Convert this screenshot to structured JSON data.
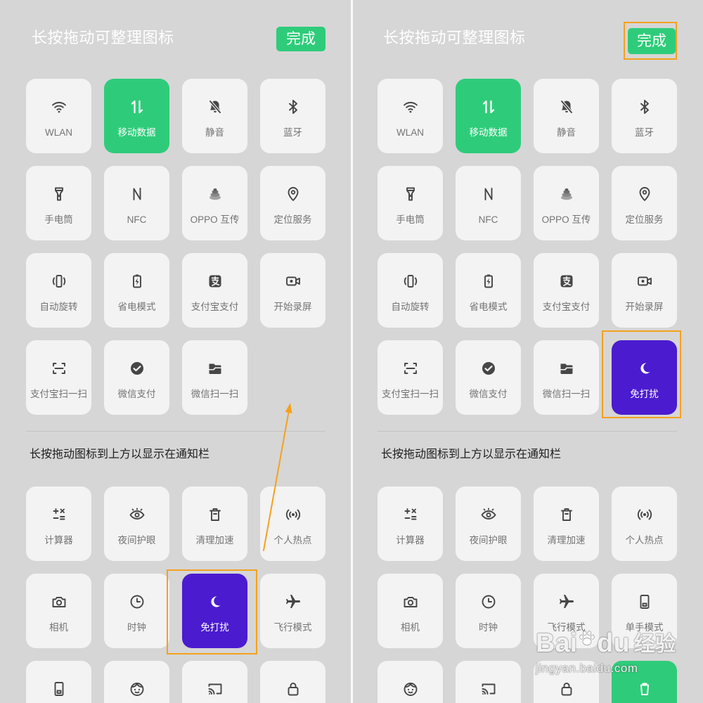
{
  "panels": [
    {
      "title": "长按拖动可整理图标",
      "done_label": "完成",
      "active_tiles": [
        {
          "label": "WLAN",
          "icon": "wifi-icon"
        },
        {
          "label": "移动数据",
          "icon": "mobile-data-icon",
          "variant": "green"
        },
        {
          "label": "静音",
          "icon": "bell-off-icon"
        },
        {
          "label": "蓝牙",
          "icon": "bluetooth-icon"
        },
        {
          "label": "手电筒",
          "icon": "flashlight-icon"
        },
        {
          "label": "NFC",
          "icon": "nfc-icon"
        },
        {
          "label": "OPPO 互传",
          "icon": "oppo-share-icon"
        },
        {
          "label": "定位服务",
          "icon": "location-icon"
        },
        {
          "label": "自动旋转",
          "icon": "rotate-icon"
        },
        {
          "label": "省电模式",
          "icon": "battery-saver-icon"
        },
        {
          "label": "支付宝支付",
          "icon": "alipay-icon"
        },
        {
          "label": "开始录屏",
          "icon": "screen-record-icon"
        },
        {
          "label": "支付宝扫一扫",
          "icon": "scan-icon"
        },
        {
          "label": "微信支付",
          "icon": "wechat-pay-icon"
        },
        {
          "label": "微信扫一扫",
          "icon": "wechat-scan-icon"
        }
      ],
      "section_hint": "长按拖动图标到上方以显示在通知栏",
      "inactive_tiles": [
        {
          "label": "计算器",
          "icon": "calculator-icon"
        },
        {
          "label": "夜间护眼",
          "icon": "eye-icon"
        },
        {
          "label": "清理加速",
          "icon": "cleanup-icon"
        },
        {
          "label": "个人热点",
          "icon": "hotspot-icon"
        },
        {
          "label": "相机",
          "icon": "camera-icon"
        },
        {
          "label": "时钟",
          "icon": "clock-icon"
        },
        {
          "label": "免打扰",
          "icon": "moon-icon",
          "variant": "purple"
        },
        {
          "label": "飞行模式",
          "icon": "airplane-icon"
        },
        {
          "icon": "one-hand-icon"
        },
        {
          "icon": "face-icon"
        },
        {
          "icon": "cast-icon"
        },
        {
          "icon": "lock-icon"
        }
      ]
    },
    {
      "title": "长按拖动可整理图标",
      "done_label": "完成",
      "active_tiles": [
        {
          "label": "WLAN",
          "icon": "wifi-icon"
        },
        {
          "label": "移动数据",
          "icon": "mobile-data-icon",
          "variant": "green"
        },
        {
          "label": "静音",
          "icon": "bell-off-icon"
        },
        {
          "label": "蓝牙",
          "icon": "bluetooth-icon"
        },
        {
          "label": "手电筒",
          "icon": "flashlight-icon"
        },
        {
          "label": "NFC",
          "icon": "nfc-icon"
        },
        {
          "label": "OPPO 互传",
          "icon": "oppo-share-icon"
        },
        {
          "label": "定位服务",
          "icon": "location-icon"
        },
        {
          "label": "自动旋转",
          "icon": "rotate-icon"
        },
        {
          "label": "省电模式",
          "icon": "battery-saver-icon"
        },
        {
          "label": "支付宝支付",
          "icon": "alipay-icon"
        },
        {
          "label": "开始录屏",
          "icon": "screen-record-icon"
        },
        {
          "label": "支付宝扫一扫",
          "icon": "scan-icon"
        },
        {
          "label": "微信支付",
          "icon": "wechat-pay-icon"
        },
        {
          "label": "微信扫一扫",
          "icon": "wechat-scan-icon"
        },
        {
          "label": "免打扰",
          "icon": "moon-icon",
          "variant": "purple"
        }
      ],
      "section_hint": "长按拖动图标到上方以显示在通知栏",
      "inactive_tiles": [
        {
          "label": "计算器",
          "icon": "calculator-icon"
        },
        {
          "label": "夜间护眼",
          "icon": "eye-icon"
        },
        {
          "label": "清理加速",
          "icon": "cleanup-icon"
        },
        {
          "label": "个人热点",
          "icon": "hotspot-icon"
        },
        {
          "label": "相机",
          "icon": "camera-icon"
        },
        {
          "label": "时钟",
          "icon": "clock-icon"
        },
        {
          "label": "飞行模式",
          "icon": "airplane-icon"
        },
        {
          "label": "单手模式",
          "icon": "one-hand-icon"
        },
        {
          "icon": "face-icon"
        },
        {
          "icon": "cast-icon"
        },
        {
          "icon": "lock-icon"
        },
        {
          "icon": "clipboard-icon",
          "variant": "green"
        }
      ]
    }
  ],
  "colors": {
    "background": "#d6d6d6",
    "tile": "#f3f3f3",
    "accent_green": "#2ecc7a",
    "dnd_purple": "#4b1bd0",
    "annotation_orange": "#f4a11d"
  },
  "watermark": {
    "brand_left": "Bai",
    "brand_right": "du",
    "brand_cn": "经验",
    "url": "jingyan.baidu.com"
  }
}
